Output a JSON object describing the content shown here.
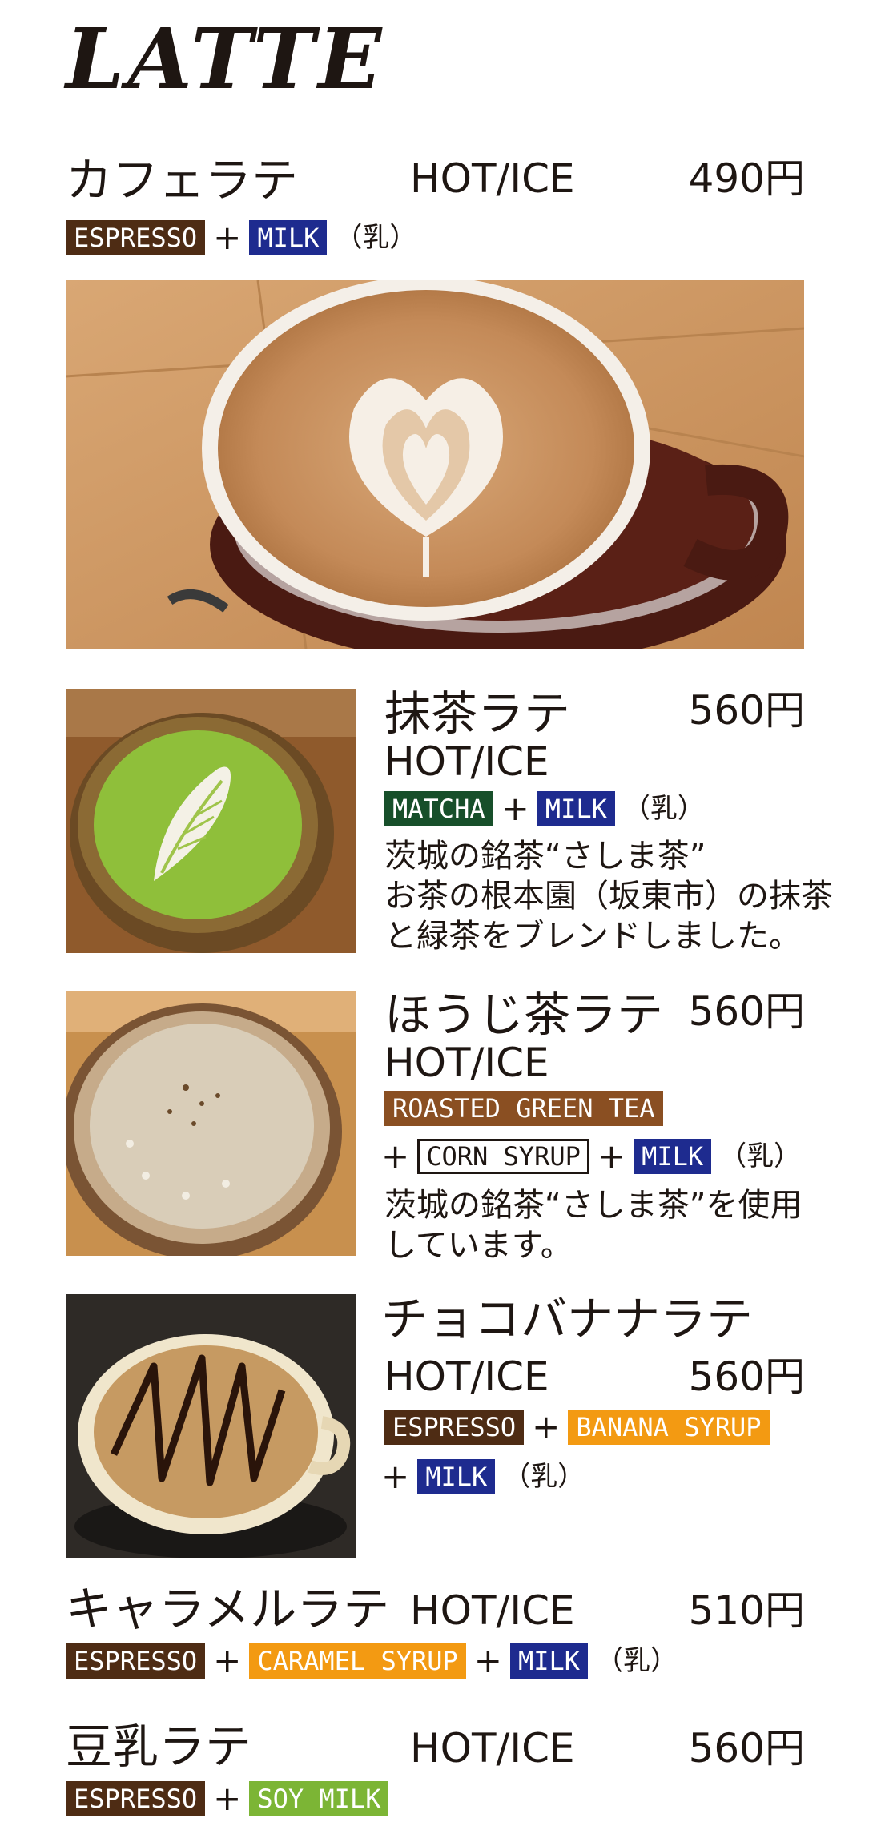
{
  "page": {
    "title": "LATTE"
  },
  "colors": {
    "espresso": "#4e2c14",
    "milk": "#1e2b8f",
    "matcha": "#174f2a",
    "roasted": "#8a4f22",
    "syrup": "#f39a12",
    "soy": "#7cb535",
    "text": "#1e1612"
  },
  "items": [
    {
      "name": "カフェラテ",
      "temp": "HOT/ICE",
      "price": "490円",
      "ingredients": {
        "t1": "ESPRESSO",
        "p1": "+",
        "t2": "MILK",
        "note": "（乳）"
      },
      "photo_icon": "heart-latte-art-cup"
    },
    {
      "name": "抹茶ラテ",
      "temp": "HOT/ICE",
      "price": "560円",
      "ingredients": {
        "t1": "MATCHA",
        "p1": "+",
        "t2": "MILK",
        "note": "（乳）"
      },
      "description": [
        "茨城の銘茶“さしま茶”",
        "お茶の根本園（坂東市）の抹茶",
        "と緑茶をブレンドしました。"
      ],
      "photo_icon": "matcha-latte-bowl"
    },
    {
      "name": "ほうじ茶ラテ",
      "temp": "HOT/ICE",
      "price": "560円",
      "ingredients": {
        "t1": "ROASTED GREEN TEA",
        "p1": "+",
        "t2": "CORN SYRUP",
        "p2": "+",
        "t3": "MILK",
        "note": "（乳）"
      },
      "description": [
        "茨城の銘茶“さしま茶”を使用",
        "しています。"
      ],
      "photo_icon": "hojicha-latte-bowl"
    },
    {
      "name": "チョコバナナラテ",
      "temp": "HOT/ICE",
      "price": "560円",
      "ingredients": {
        "t1": "ESPRESSO",
        "p1": "+",
        "t2": "BANANA SYRUP",
        "p2": "+",
        "t3": "MILK",
        "note": "（乳）"
      },
      "photo_icon": "chocolate-drizzle-latte"
    },
    {
      "name": "キャラメルラテ",
      "temp": "HOT/ICE",
      "price": "510円",
      "ingredients": {
        "t1": "ESPRESSO",
        "p1": "+",
        "t2": "CARAMEL SYRUP",
        "p2": "+",
        "t3": "MILK",
        "note": "（乳）"
      }
    },
    {
      "name": "豆乳ラテ",
      "temp": "HOT/ICE",
      "price": "560円",
      "ingredients": {
        "t1": "ESPRESSO",
        "p1": "+",
        "t2": "SOY MILK"
      }
    }
  ]
}
